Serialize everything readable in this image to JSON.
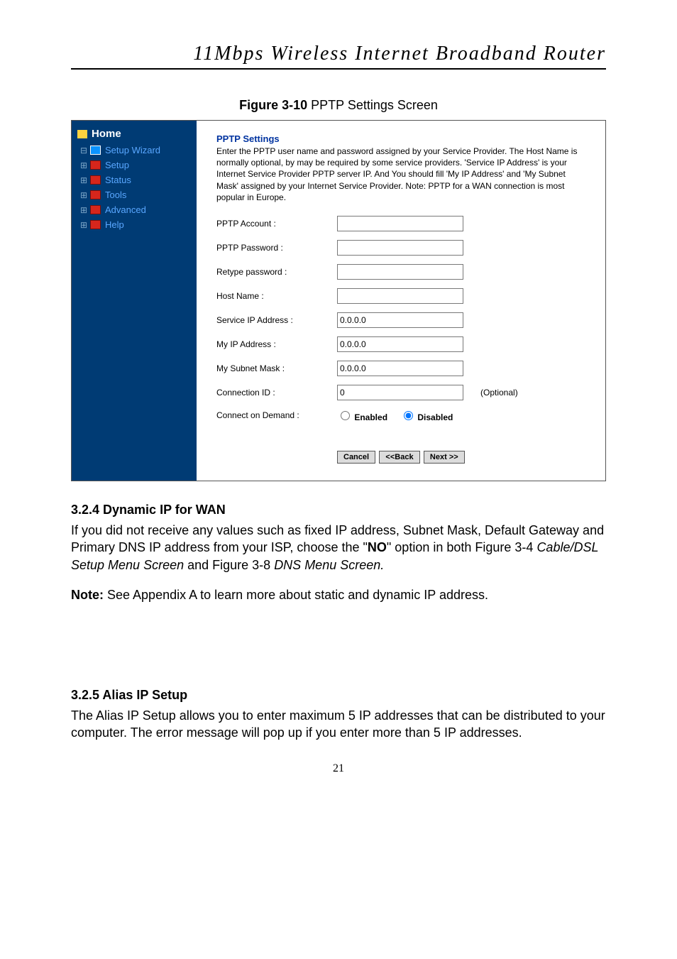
{
  "header": {
    "title": "11Mbps  Wireless  Internet  Broadband  Router"
  },
  "figure": {
    "label_bold": "Figure 3-10",
    "label_rest": " PPTP Settings Screen"
  },
  "sidebar": {
    "home": "Home",
    "items": [
      {
        "label": "Setup Wizard",
        "icon": "wizard",
        "glyph": "⊟"
      },
      {
        "label": "Setup",
        "icon": "folder",
        "glyph": "⊞"
      },
      {
        "label": "Status",
        "icon": "folder",
        "glyph": "⊞"
      },
      {
        "label": "Tools",
        "icon": "folder",
        "glyph": "⊞"
      },
      {
        "label": "Advanced",
        "icon": "folder",
        "glyph": "⊞"
      },
      {
        "label": "Help",
        "icon": "folder",
        "glyph": "⊞"
      }
    ]
  },
  "panel": {
    "heading": "PPTP Settings",
    "description": "Enter the PPTP user name and password assigned by your Service Provider. The Host Name is normally optional, by may be required by some service providers. 'Service IP Address' is your Internet Service Provider PPTP server IP. And You should fill 'My IP Address' and 'My Subnet Mask' assigned by your Internet Service Provider. Note: PPTP for a WAN connection is most popular in Europe.",
    "fields": {
      "pptp_account_label": "PPTP Account :",
      "pptp_account_value": "",
      "pptp_password_label": "PPTP Password :",
      "pptp_password_value": "",
      "retype_password_label": "Retype password :",
      "retype_password_value": "",
      "host_name_label": "Host Name :",
      "host_name_value": "",
      "service_ip_label": "Service IP Address :",
      "service_ip_value": "0.0.0.0",
      "my_ip_label": "My IP Address :",
      "my_ip_value": "0.0.0.0",
      "my_subnet_label": "My Subnet Mask :",
      "my_subnet_value": "0.0.0.0",
      "connection_id_label": "Connection ID :",
      "connection_id_value": "0",
      "connection_id_optional": "(Optional)",
      "connect_demand_label": "Connect on Demand :",
      "enabled_label": "Enabled",
      "disabled_label": "Disabled",
      "connect_demand_selected": "disabled"
    },
    "buttons": {
      "cancel": "Cancel",
      "back": "<<Back",
      "next": "Next >>"
    }
  },
  "section_324": {
    "heading": "3.2.4 Dynamic IP for WAN",
    "p1_a": "If you did not receive any values such as fixed IP address, Subnet Mask, Default Gateway and Primary DNS IP address from your ISP, choose the \"",
    "p1_bold": "NO",
    "p1_b": "\" option in both Figure 3-4 ",
    "p1_italic1": "Cable/DSL Setup Menu Screen",
    "p1_c": " and Figure 3-8 ",
    "p1_italic2": "DNS Menu Screen.",
    "note_bold": "Note:",
    "note_rest": " See Appendix A to learn more about static and dynamic IP address."
  },
  "section_325": {
    "heading": "3.2.5 Alias IP Setup",
    "p1": "The Alias IP Setup allows you to enter maximum 5 IP addresses that can be distributed to your computer. The error message will pop up if you enter more than 5 IP addresses."
  },
  "page_number": "21"
}
